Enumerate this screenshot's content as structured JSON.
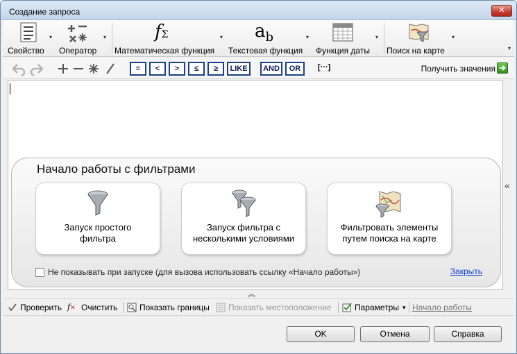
{
  "window": {
    "title": "Создание запроса",
    "close_glyph": "✕"
  },
  "ribbon": {
    "items": [
      {
        "label": "Свойство",
        "icon": "property-list-icon"
      },
      {
        "label": "Оператор",
        "icon": "operators-icon"
      },
      {
        "label": "Математическая функция",
        "icon": "math-function-icon",
        "icon_text": "f",
        "icon_sub": "Σ"
      },
      {
        "label": "Текстовая функция",
        "icon": "text-function-icon",
        "icon_text": "a",
        "icon_sub": "b"
      },
      {
        "label": "Функция даты",
        "icon": "calendar-icon"
      },
      {
        "label": "Поиск на карте",
        "icon": "map-filter-icon"
      }
    ],
    "dropdown_glyph": "▾",
    "scroll_glyph": "▾"
  },
  "toolbar": {
    "operators": [
      "=",
      "<",
      ">",
      "≤",
      "≥",
      "LIKE",
      "AND",
      "OR"
    ],
    "brackets": "[···]",
    "get_values_label": "Получить значения"
  },
  "start_panel": {
    "title": "Начало работы с фильтрами",
    "cards": [
      {
        "label_line1": "Запуск простого",
        "label_line2": "фильтра",
        "icon": "funnel-icon"
      },
      {
        "label_line1": "Запуск фильтра с",
        "label_line2": "несколькими условиями",
        "icon": "double-funnel-icon"
      },
      {
        "label_line1": "Фильтровать элементы",
        "label_line2": "путем поиска на карте",
        "icon": "map-funnel-icon"
      }
    ],
    "dont_show_label": "Не показывать при запуске (для вызова использовать ссылку «Начало работы»)",
    "close_link": "Закрыть"
  },
  "chevrons": {
    "side": "«",
    "bottom": "︽"
  },
  "statusbar": {
    "check": "Проверить",
    "clear": "Очистить",
    "show_bounds": "Показать границы",
    "show_location": "Показать местоположение",
    "params": "Параметры",
    "params_dd": "▾",
    "start_link": "Начало работы"
  },
  "buttons": {
    "ok": "OK",
    "cancel": "Отмена",
    "help": "Справка"
  },
  "colors": {
    "operator_border": "#1a3f8a",
    "link": "#0b3bd1",
    "accent_green": "#2f8f1c"
  }
}
